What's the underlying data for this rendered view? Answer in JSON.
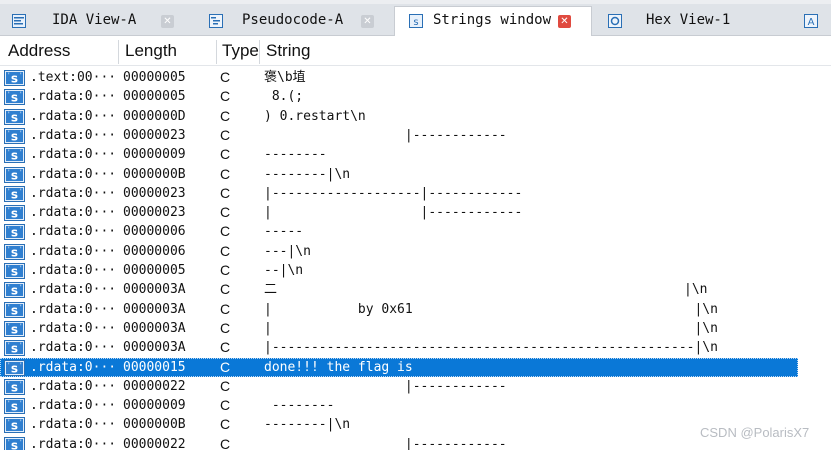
{
  "tabs": [
    {
      "label": "IDA View-A",
      "icon": "ida-view-icon",
      "active": false
    },
    {
      "label": "Pseudocode-A",
      "icon": "pseudocode-icon",
      "active": false
    },
    {
      "label": "Strings window",
      "icon": "strings-window-icon",
      "active": true
    },
    {
      "label": "Hex View-1",
      "icon": "hex-view-icon",
      "active": false
    },
    {
      "label": "",
      "icon": "structures-icon",
      "active": false
    }
  ],
  "columns": {
    "address": "Address",
    "length": "Length",
    "type": "Type",
    "string": "String"
  },
  "rows": [
    {
      "address": ".text:00···",
      "length": "00000005",
      "type": "C",
      "string": "褒\\b埴"
    },
    {
      "address": ".rdata:0···",
      "length": "00000005",
      "type": "C",
      "string": " 8.(;"
    },
    {
      "address": ".rdata:0···",
      "length": "0000000D",
      "type": "C",
      "string": ") 0.restart\\n"
    },
    {
      "address": ".rdata:0···",
      "length": "00000023",
      "type": "C",
      "string": "                  |------------"
    },
    {
      "address": ".rdata:0···",
      "length": "00000009",
      "type": "C",
      "string": "--------"
    },
    {
      "address": ".rdata:0···",
      "length": "0000000B",
      "type": "C",
      "string": "--------|\\n"
    },
    {
      "address": ".rdata:0···",
      "length": "00000023",
      "type": "C",
      "string": "|-------------------|------------"
    },
    {
      "address": ".rdata:0···",
      "length": "00000023",
      "type": "C",
      "string": "|                   |------------"
    },
    {
      "address": ".rdata:0···",
      "length": "00000006",
      "type": "C",
      "string": "-----"
    },
    {
      "address": ".rdata:0···",
      "length": "00000006",
      "type": "C",
      "string": "---|\\n"
    },
    {
      "address": ".rdata:0···",
      "length": "00000005",
      "type": "C",
      "string": "--|\\n"
    },
    {
      "address": ".rdata:0···",
      "length": "0000003A",
      "type": "C",
      "string": "二                                                    |\\n"
    },
    {
      "address": ".rdata:0···",
      "length": "0000003A",
      "type": "C",
      "string": "|           by 0x61                                    |\\n"
    },
    {
      "address": ".rdata:0···",
      "length": "0000003A",
      "type": "C",
      "string": "|                                                      |\\n"
    },
    {
      "address": ".rdata:0···",
      "length": "0000003A",
      "type": "C",
      "string": "|------------------------------------------------------|\\n"
    },
    {
      "address": ".rdata:0···",
      "length": "00000015",
      "type": "C",
      "string": "done!!! the flag is",
      "selected": true
    },
    {
      "address": ".rdata:0···",
      "length": "00000022",
      "type": "C",
      "string": "                  |------------"
    },
    {
      "address": ".rdata:0···",
      "length": "00000009",
      "type": "C",
      "string": " --------"
    },
    {
      "address": ".rdata:0···",
      "length": "0000000B",
      "type": "C",
      "string": "--------|\\n"
    },
    {
      "address": ".rdata:0···",
      "length": "00000022",
      "type": "C",
      "string": "                  |------------"
    }
  ],
  "watermark": "CSDN @PolarisX7",
  "colors": {
    "selection": "#0a78d7",
    "close_active": "#e04a3f",
    "tabbar": "#dfe3e8"
  }
}
